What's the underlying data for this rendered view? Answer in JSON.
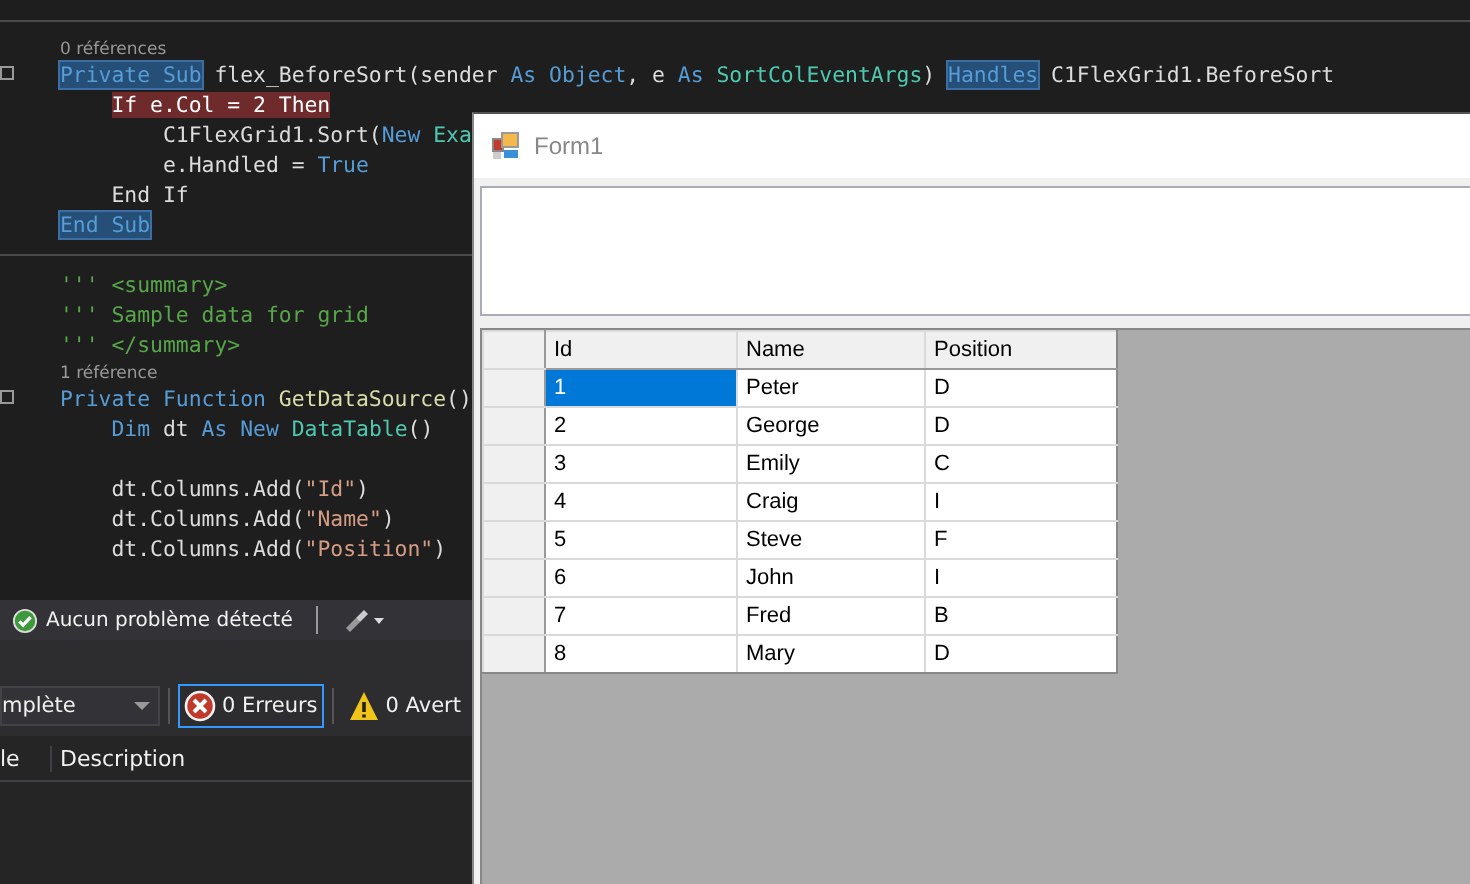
{
  "editor": {
    "lines": [
      {
        "kind": "codelens",
        "text": "0 références"
      },
      {
        "kind": "code",
        "tokens": [
          {
            "text": "Private Sub",
            "kind": "match"
          },
          {
            "text": " flex_BeforeSort(sender ",
            "kind": "plain"
          },
          {
            "text": "As Object",
            "kind": "keyword"
          },
          {
            "text": ", e ",
            "kind": "plain"
          },
          {
            "text": "As",
            "kind": "keyword"
          },
          {
            "text": " SortColEventArgs",
            "kind": "type"
          },
          {
            "text": ") ",
            "kind": "plain"
          },
          {
            "text": "Handles",
            "kind": "match"
          },
          {
            "text": " C1FlexGrid1.BeforeSort",
            "kind": "plain"
          }
        ],
        "children": [
          {
            "kind": "code",
            "tokens": [
              {
                "text": "If e.Col = 2 Then",
                "kind": "flagged"
              }
            ],
            "children": [
              {
                "kind": "code",
                "tokens": [
                  {
                    "text": "C1FlexGrid1.Sort(",
                    "kind": "plain"
                  },
                  {
                    "text": "New",
                    "kind": "keyword"
                  },
                  {
                    "text": " Exa",
                    "kind": "type"
                  }
                ]
              },
              {
                "kind": "code",
                "tokens": [
                  {
                    "text": "e.Handled = ",
                    "kind": "plain"
                  },
                  {
                    "text": "True",
                    "kind": "keyword"
                  }
                ]
              }
            ]
          },
          {
            "kind": "code",
            "tokens": [
              {
                "text": "End If",
                "kind": "plain"
              }
            ]
          }
        ]
      },
      {
        "kind": "code",
        "tokens": [
          {
            "text": "End Sub",
            "kind": "match"
          }
        ]
      },
      {
        "kind": "separator"
      },
      {
        "kind": "code",
        "tokens": [
          {
            "text": "''' <summary>",
            "kind": "comment"
          }
        ]
      },
      {
        "kind": "code",
        "tokens": [
          {
            "text": "''' Sample data for grid",
            "kind": "comment"
          }
        ]
      },
      {
        "kind": "code",
        "tokens": [
          {
            "text": "''' </summary>",
            "kind": "comment"
          }
        ]
      },
      {
        "kind": "codelens",
        "text": "1 référence"
      },
      {
        "kind": "code",
        "tokens": [
          {
            "text": "Private Function",
            "kind": "keyword"
          },
          {
            "text": " GetDataSource",
            "kind": "method"
          },
          {
            "text": "()",
            "kind": "plain"
          }
        ],
        "children": [
          {
            "kind": "code",
            "tokens": [
              {
                "text": "Dim",
                "kind": "keyword"
              },
              {
                "text": " dt ",
                "kind": "plain"
              },
              {
                "text": "As New",
                "kind": "keyword"
              },
              {
                "text": " DataTable",
                "kind": "type"
              },
              {
                "text": "()",
                "kind": "plain"
              }
            ]
          },
          {
            "kind": "code"
          },
          {
            "kind": "code",
            "tokens": [
              {
                "text": "dt.Columns.Add(",
                "kind": "plain"
              },
              {
                "text": "\"Id\"",
                "kind": "string"
              },
              {
                "text": ")",
                "kind": "plain"
              }
            ]
          },
          {
            "kind": "code",
            "tokens": [
              {
                "text": "dt.Columns.Add(",
                "kind": "plain"
              },
              {
                "text": "\"Name\"",
                "kind": "string"
              },
              {
                "text": ")",
                "kind": "plain"
              }
            ]
          },
          {
            "kind": "code",
            "tokens": [
              {
                "text": "dt.Columns.Add(",
                "kind": "plain"
              },
              {
                "text": "\"Position\"",
                "kind": "string"
              },
              {
                "text": ")",
                "kind": "plain"
              }
            ]
          }
        ]
      }
    ]
  },
  "status_bar": {
    "message": "Aucun problème détecté"
  },
  "error_list": {
    "filter": "mplète",
    "errors": "0 Erreurs",
    "warnings": "0 Avert",
    "columns": [
      "le",
      "Description"
    ]
  },
  "form": {
    "title": "Form1",
    "grid": {
      "columns": [
        "Id",
        "Name",
        "Position"
      ],
      "rows": [
        {
          "cells": [
            "1",
            "Peter",
            "D"
          ],
          "selected": true
        },
        {
          "cells": [
            "2",
            "George",
            "D"
          ],
          "selected": false
        },
        {
          "cells": [
            "3",
            "Emily",
            "C"
          ],
          "selected": false
        },
        {
          "cells": [
            "4",
            "Craig",
            "I"
          ],
          "selected": false
        },
        {
          "cells": [
            "5",
            "Steve",
            "F"
          ],
          "selected": false
        },
        {
          "cells": [
            "6",
            "John",
            "I"
          ],
          "selected": false
        },
        {
          "cells": [
            "7",
            "Fred",
            "B"
          ],
          "selected": false
        },
        {
          "cells": [
            "8",
            "Mary",
            "D"
          ],
          "selected": false
        }
      ]
    }
  }
}
